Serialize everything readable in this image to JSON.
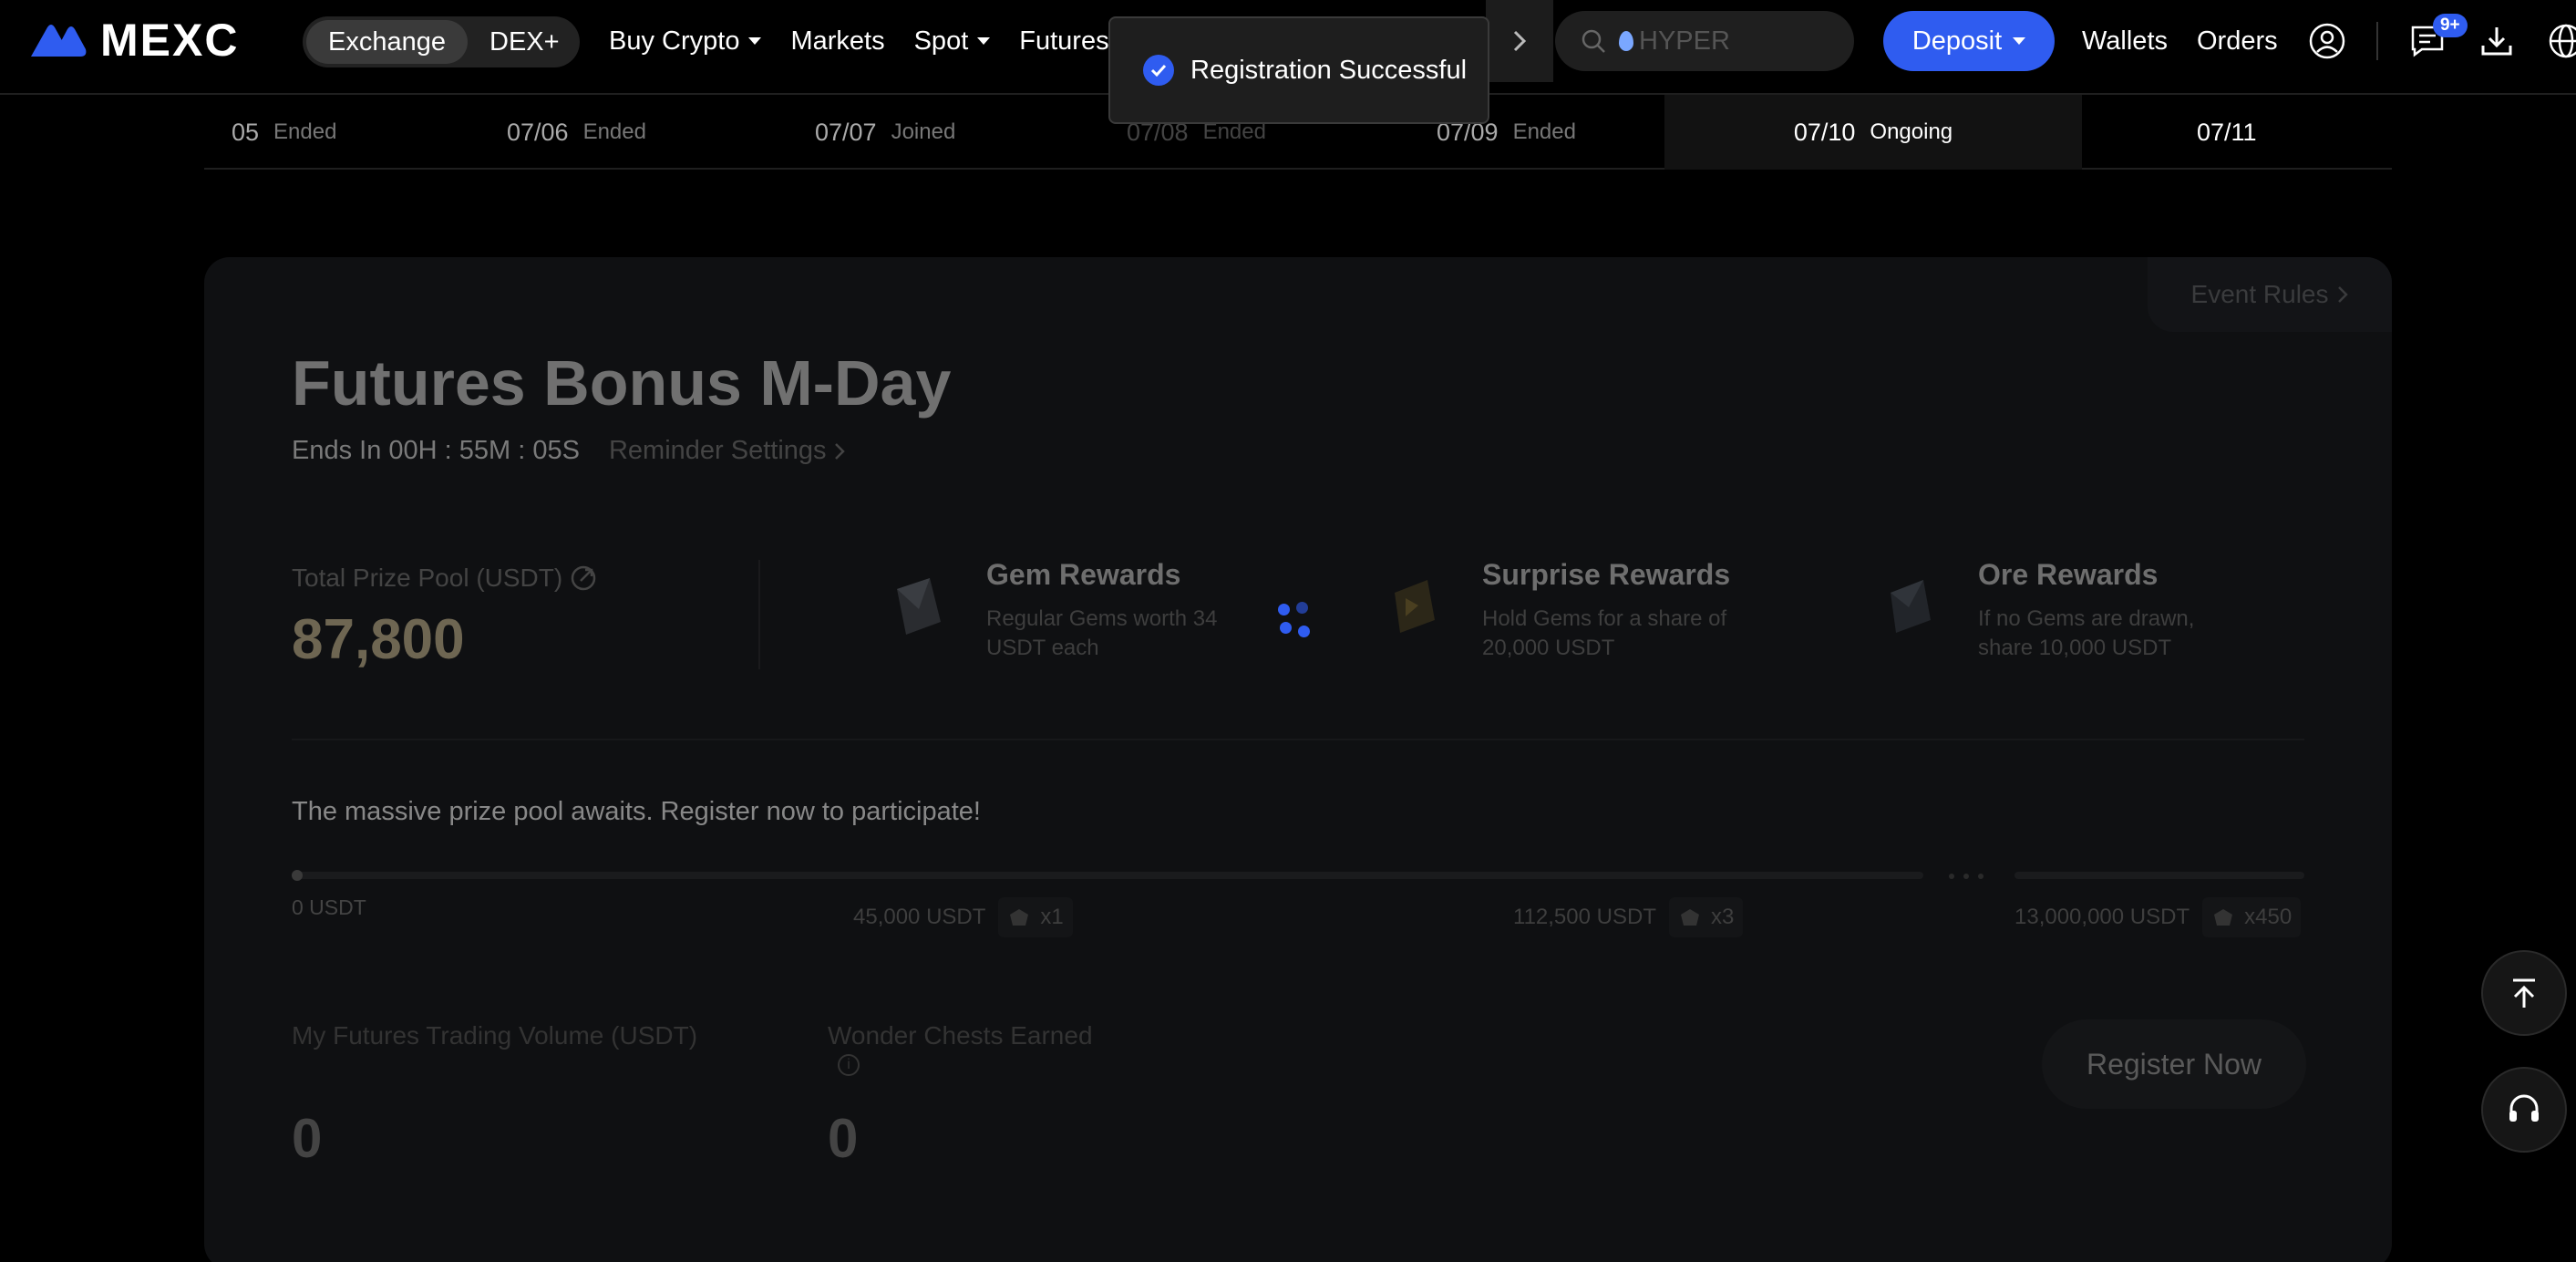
{
  "nav": {
    "logo_text": "MEXC",
    "segments": [
      "Exchange",
      "DEX+"
    ],
    "links": [
      "Buy Crypto",
      "Markets",
      "Spot",
      "Futures"
    ],
    "search_placeholder": "HYPER",
    "deposit_label": "Deposit",
    "wallets_label": "Wallets",
    "orders_label": "Orders",
    "messages_badge": "9+"
  },
  "toast": {
    "text": "Registration Successful"
  },
  "dates": [
    {
      "day": "05",
      "status": "Ended"
    },
    {
      "day": "07/06",
      "status": "Ended"
    },
    {
      "day": "07/07",
      "status": "Joined"
    },
    {
      "day": "07/08",
      "status": "Ended"
    },
    {
      "day": "07/09",
      "status": "Ended"
    },
    {
      "day": "07/10",
      "status": "Ongoing"
    },
    {
      "day": "07/11",
      "status": ""
    }
  ],
  "event": {
    "rules_label": "Event Rules",
    "title": "Futures Bonus M-Day",
    "ends_in": "Ends In 00H : 55M : 05S",
    "reminder_label": "Reminder Settings",
    "pool_label": "Total Prize Pool (USDT)",
    "pool_value": "87,800",
    "rewards": [
      {
        "title": "Gem Rewards",
        "desc": "Regular Gems worth 34 USDT each"
      },
      {
        "title": "Surprise Rewards",
        "desc": "Hold Gems for a share of 20,000 USDT"
      },
      {
        "title": "Ore Rewards",
        "desc": "If no Gems are drawn, share 10,000 USDT"
      }
    ],
    "prompt": "The massive prize pool awaits. Register now to participate!",
    "milestone_start": "0 USDT",
    "milestones": [
      {
        "amount": "45,000 USDT",
        "mult": "x1"
      },
      {
        "amount": "112,500 USDT",
        "mult": "x3"
      },
      {
        "amount": "13,000,000 USDT",
        "mult": "x450"
      }
    ],
    "volume_label": "My Futures Trading Volume (USDT)",
    "volume_value": "0",
    "chests_label": "Wonder Chests Earned",
    "chests_value": "0",
    "register_label": "Register Now"
  },
  "colors": {
    "accent": "#2f5cf0",
    "background": "#000000"
  }
}
